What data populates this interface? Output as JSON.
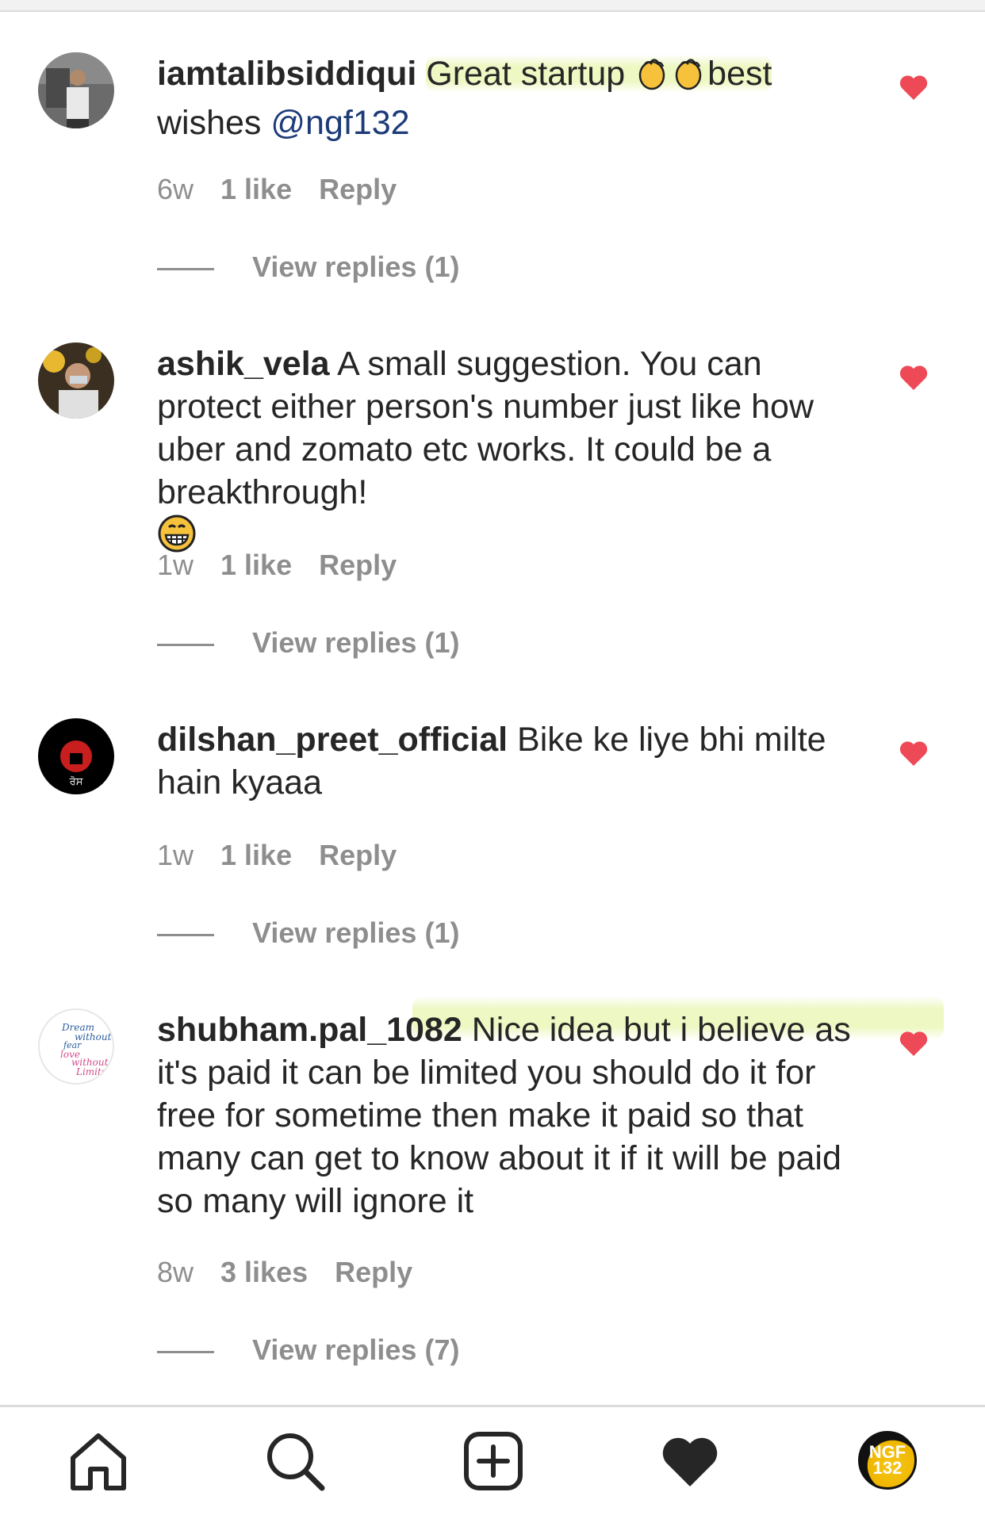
{
  "comments": [
    {
      "username": "iamtalibsiddiqui",
      "text_parts": [
        " ",
        "Great startup ",
        "best",
        "wishes ",
        "@ngf132"
      ],
      "time": "6w",
      "likes": "1 like",
      "reply": "Reply",
      "view_replies": "View replies (1)"
    },
    {
      "username": "ashik_vela",
      "text": "A small suggestion. You can protect either person's number just like how uber and zomato etc works. It could be a breakthrough!",
      "time": "1w",
      "likes": "1 like",
      "reply": "Reply",
      "view_replies": "View replies (1)"
    },
    {
      "username": "dilshan_preet_official",
      "text": "Bike ke liye bhi milte hain kyaaa",
      "time": "1w",
      "likes": "1 like",
      "reply": "Reply",
      "view_replies": "View replies (1)"
    },
    {
      "username": "shubham.pal_1082",
      "text": "Nice idea but i believe as it's paid it can be limited you should do it for free for sometime then make it paid so that many can get to know about it if it will be paid so many will ignore it",
      "time": "8w",
      "likes": "3 likes",
      "reply": "Reply",
      "view_replies": "View replies (7)"
    }
  ],
  "avatars": {
    "dilshan_logo_text": "ਰੋਸ",
    "shubham_logo_text": [
      "Dream",
      "without",
      "fear",
      "love",
      "without",
      "Limits"
    ]
  },
  "nav": {
    "items": [
      "home-icon",
      "search-icon",
      "new-post-icon",
      "activity-heart-icon",
      "profile-avatar"
    ],
    "profile_text_1": "NGF",
    "profile_text_2": "132"
  },
  "colors": {
    "heart": "#ed4956",
    "mention": "#1d3b78",
    "muted": "#8e8e8e",
    "highlight": "#e8f5af"
  }
}
